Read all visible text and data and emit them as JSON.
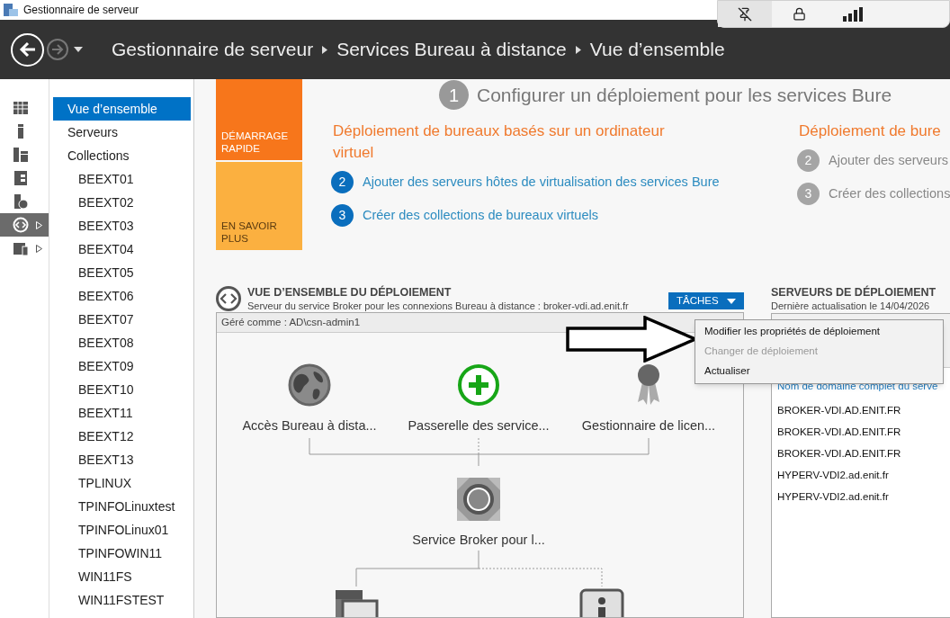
{
  "window": {
    "title": "Gestionnaire de serveur"
  },
  "breadcrumb": [
    "Gestionnaire de serveur",
    "Services Bureau à distance",
    "Vue d’ensemble"
  ],
  "rail": [
    {
      "kind": "dashboard",
      "selected": false,
      "expandable": false
    },
    {
      "kind": "local",
      "selected": false,
      "expandable": false
    },
    {
      "kind": "all",
      "selected": false,
      "expandable": false
    },
    {
      "kind": "files",
      "selected": false,
      "expandable": false
    },
    {
      "kind": "web",
      "selected": false,
      "expandable": false
    },
    {
      "kind": "rds",
      "selected": true,
      "expandable": true
    },
    {
      "kind": "folder",
      "selected": false,
      "expandable": true
    }
  ],
  "nav": [
    {
      "label": "Vue d’ensemble",
      "selected": true
    },
    {
      "label": "Serveurs",
      "selected": false
    },
    {
      "label": "Collections",
      "selected": false,
      "children": [
        {
          "label": "BEEXT01",
          "selected": false
        },
        {
          "label": "BEEXT02",
          "selected": false
        },
        {
          "label": "BEEXT03",
          "selected": false
        },
        {
          "label": "BEEXT04",
          "selected": false
        },
        {
          "label": "BEEXT05",
          "selected": false
        },
        {
          "label": "BEEXT06",
          "selected": false
        },
        {
          "label": "BEEXT07",
          "selected": false
        },
        {
          "label": "BEEXT08",
          "selected": false
        },
        {
          "label": "BEEXT09",
          "selected": false
        },
        {
          "label": "BEEXT10",
          "selected": false
        },
        {
          "label": "BEEXT11",
          "selected": false
        },
        {
          "label": "BEEXT12",
          "selected": false
        },
        {
          "label": "BEEXT13",
          "selected": false
        },
        {
          "label": "TPLINUX",
          "selected": false
        },
        {
          "label": "TPINFOLinuxtest",
          "selected": false
        },
        {
          "label": "TPINFOLinux01",
          "selected": false
        },
        {
          "label": "TPINFOWIN11",
          "selected": false
        },
        {
          "label": "WIN11FS",
          "selected": false
        },
        {
          "label": "WIN11FSTEST",
          "selected": false
        }
      ]
    }
  ],
  "tiles": [
    {
      "kind": "quick",
      "label": "DÉMARRAGE RAPIDE"
    },
    {
      "kind": "learn",
      "label": "EN SAVOIR PLUS"
    }
  ],
  "quick_start": {
    "step": "1",
    "title": "Configurer un déploiement pour les services Bure",
    "columns": [
      {
        "heading": "Déploiement de bureaux basés sur un ordinateur virtuel",
        "steps": [
          {
            "number": "2",
            "label": "Ajouter des serveurs hôtes de virtualisation des services Bure",
            "disabled": false
          },
          {
            "number": "3",
            "label": "Créer des collections de bureaux virtuels",
            "disabled": false
          }
        ]
      },
      {
        "heading": "Déploiement de bure",
        "steps": [
          {
            "number": "2",
            "label": "Ajouter des serveurs",
            "disabled": true
          },
          {
            "number": "3",
            "label": "Créer des collections",
            "disabled": true
          }
        ]
      }
    ]
  },
  "deployment_overview": {
    "title": "VUE D’ENSEMBLE DU DÉPLOIEMENT",
    "subtitle": "Serveur du service Broker pour les connexions Bureau à distance : broker-vdi.ad.enit.fr",
    "tasks_button": "TÂCHES",
    "managed_as": "Géré comme : AD\\csn-admin1",
    "nodes": [
      {
        "kind": "globe",
        "label": "Accès Bureau à dista..."
      },
      {
        "kind": "gateway",
        "label": "Passerelle des service..."
      },
      {
        "kind": "license",
        "label": "Gestionnaire de licen..."
      },
      {
        "kind": "broker",
        "label": "Service Broker pour l..."
      },
      {
        "kind": "host"
      },
      {
        "kind": "info"
      }
    ]
  },
  "tasks_menu": [
    {
      "label": "Modifier les propriétés de déploiement",
      "disabled": false
    },
    {
      "label": "Changer de déploiement",
      "disabled": true
    },
    {
      "label": "Actualiser",
      "disabled": false
    }
  ],
  "deployment_servers": {
    "title": "SERVEURS DE DÉPLOIEMENT",
    "subtitle": "Dernière actualisation le 14/04/2026",
    "column": "Nom de domaine complet du serve",
    "rows": [
      "BROKER-VDI.AD.ENIT.FR",
      "BROKER-VDI.AD.ENIT.FR",
      "BROKER-VDI.AD.ENIT.FR",
      "HYPERV-VDI2.ad.enit.fr",
      "HYPERV-VDI2.ad.enit.fr"
    ]
  }
}
